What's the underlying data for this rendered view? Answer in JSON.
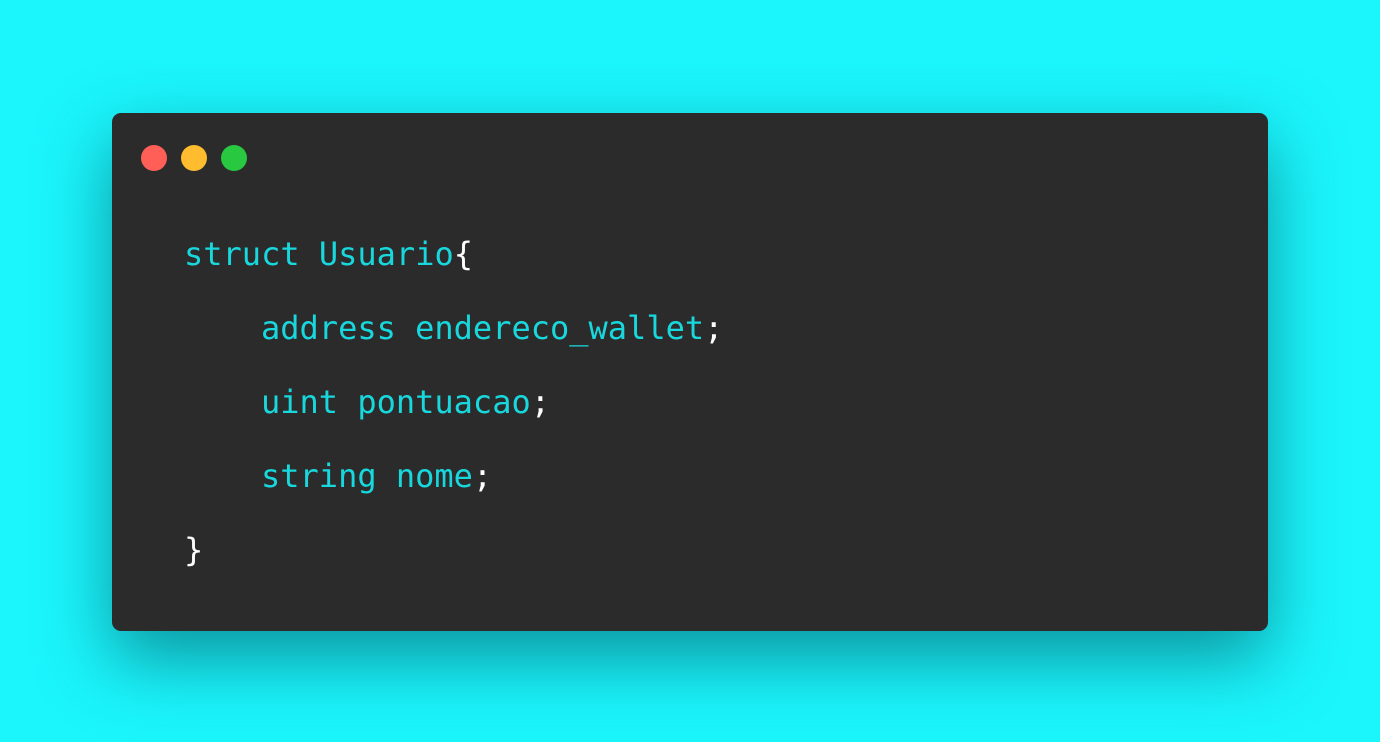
{
  "window": {
    "controls": [
      {
        "name": "close",
        "color": "#ff5f57"
      },
      {
        "name": "minimize",
        "color": "#febc2e"
      },
      {
        "name": "maximize",
        "color": "#28c840"
      }
    ],
    "background_color": "#2b2b2b"
  },
  "page": {
    "background_color": "#1bf5fc"
  },
  "code": {
    "lines": [
      {
        "tokens": [
          {
            "kind": "keyword",
            "text": "struct"
          },
          {
            "kind": "space",
            "text": " "
          },
          {
            "kind": "ident",
            "text": "Usuario"
          },
          {
            "kind": "punct",
            "text": "{"
          }
        ]
      },
      {
        "tokens": [
          {
            "kind": "keyword",
            "text": "address"
          },
          {
            "kind": "space",
            "text": " "
          },
          {
            "kind": "ident",
            "text": "endereco_wallet"
          },
          {
            "kind": "punct",
            "text": ";"
          }
        ]
      },
      {
        "tokens": [
          {
            "kind": "keyword",
            "text": "uint"
          },
          {
            "kind": "space",
            "text": " "
          },
          {
            "kind": "ident",
            "text": "pontuacao"
          },
          {
            "kind": "punct",
            "text": ";"
          }
        ]
      },
      {
        "tokens": [
          {
            "kind": "keyword",
            "text": "string"
          },
          {
            "kind": "space",
            "text": " "
          },
          {
            "kind": "ident",
            "text": "nome"
          },
          {
            "kind": "punct",
            "text": ";"
          }
        ]
      },
      {
        "tokens": [
          {
            "kind": "punct",
            "text": "}"
          }
        ]
      }
    ]
  }
}
